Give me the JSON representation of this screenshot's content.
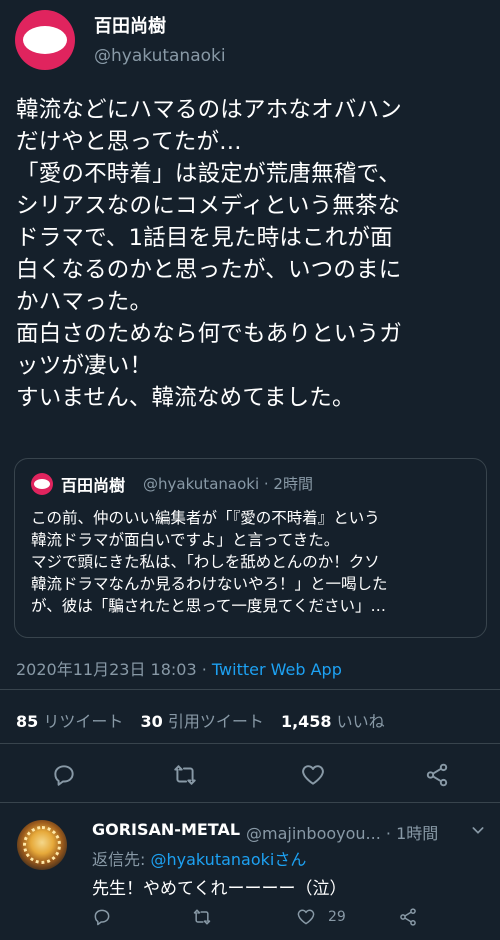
{
  "tweet": {
    "author_name": "百田尚樹",
    "author_handle": "@hyakutanaoki",
    "text": "韓流などにハマるのはアホなオバハン\nだけやと思ってたが…\n「愛の不時着」は設定が荒唐無稽で、\nシリアスなのにコメディという無茶な\nドラマで、1話目を見た時はこれが面\n白くなるのかと思ったが、いつのまに\nかハマった。\n面白さのためなら何でもありというガ\nッツが凄い！\nすいません、韓流なめてました。",
    "datetime": "2020年11月23日 18:03 · ",
    "source_app": "Twitter Web App"
  },
  "quote": {
    "author_name": "百田尚樹",
    "meta": "@hyakutanaoki · 2時間",
    "text": "この前、仲のいい編集者が「『愛の不時着』という\n韓流ドラマが面白いですよ」と言ってきた。\nマジで頭にきた私は、「わしを舐めとんのか！クソ\n韓流ドラマなんか見るわけないやろ！」と一喝した\nが、彼は「騙されたと思って一度見てください」…"
  },
  "stats": {
    "retweets_count": "85",
    "retweets_label": "リツイート",
    "quotes_count": "30",
    "quotes_label": "引用ツイート",
    "likes_count": "1,458",
    "likes_label": "いいね"
  },
  "actions": {
    "icons": [
      "reply-icon",
      "retweet-icon",
      "like-icon",
      "share-icon"
    ]
  },
  "reply": {
    "author_name": "GORISAN-METAL",
    "meta": "@majinbooyou... · 1時間",
    "reply_to_prefix": "返信先: ",
    "reply_to_handle": "@hyakutanaoki",
    "reply_to_suffix": "さん",
    "text": "先生！やめてくれーーーー（泣）",
    "like_count": "29"
  },
  "colors": {
    "background": "#15202b",
    "muted": "#8899a6",
    "accent": "#1da1f2",
    "divider": "#38444d",
    "avatar": "#e0245e"
  }
}
